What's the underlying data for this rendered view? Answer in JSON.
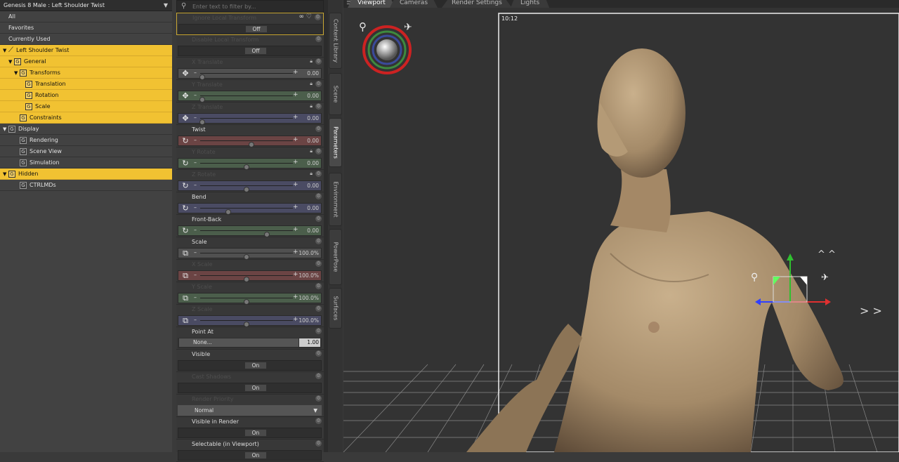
{
  "node_selector": {
    "label": "Genesis 8 Male : Left Shoulder Twist",
    "arrow": "▼"
  },
  "tree": [
    {
      "label": "All",
      "indent": 0,
      "selected": false,
      "toggle": "",
      "icon": ""
    },
    {
      "label": "Favorites",
      "indent": 0,
      "selected": false,
      "toggle": "",
      "icon": ""
    },
    {
      "label": "Currently Used",
      "indent": 0,
      "selected": false,
      "toggle": "",
      "icon": ""
    },
    {
      "label": "Left Shoulder Twist",
      "indent": 0,
      "selected": true,
      "toggle": "▼",
      "icon": "bone"
    },
    {
      "label": "General",
      "indent": 1,
      "selected": true,
      "toggle": "▼",
      "icon": "G"
    },
    {
      "label": "Transforms",
      "indent": 2,
      "selected": true,
      "toggle": "▼",
      "icon": "G"
    },
    {
      "label": "Translation",
      "indent": 3,
      "selected": true,
      "toggle": "",
      "icon": "G"
    },
    {
      "label": "Rotation",
      "indent": 3,
      "selected": true,
      "toggle": "",
      "icon": "G"
    },
    {
      "label": "Scale",
      "indent": 3,
      "selected": true,
      "toggle": "",
      "icon": "G"
    },
    {
      "label": "Constraints",
      "indent": 2,
      "selected": true,
      "toggle": "",
      "icon": "G"
    },
    {
      "label": "Display",
      "indent": 0,
      "selected": false,
      "toggle": "▼",
      "icon": "G"
    },
    {
      "label": "Rendering",
      "indent": 2,
      "selected": false,
      "toggle": "",
      "icon": "G"
    },
    {
      "label": "Scene View",
      "indent": 2,
      "selected": false,
      "toggle": "",
      "icon": "G"
    },
    {
      "label": "Simulation",
      "indent": 2,
      "selected": false,
      "toggle": "",
      "icon": "G"
    },
    {
      "label": "Hidden",
      "indent": 0,
      "selected": true,
      "toggle": "▼",
      "icon": "G"
    },
    {
      "label": "CTRLMDs",
      "indent": 2,
      "selected": false,
      "toggle": "",
      "icon": "G"
    }
  ],
  "search": {
    "placeholder": "Enter text to filter by..."
  },
  "params": [
    {
      "kind": "toggle",
      "label": "Ignore Local Transform",
      "dim": true,
      "value": "Off",
      "highlight": true
    },
    {
      "kind": "toggle",
      "label": "Disable Local Transform",
      "dim": true,
      "value": "Off"
    },
    {
      "kind": "slider",
      "label": "X Translate",
      "dim": true,
      "color": "#505050",
      "icon": "move",
      "pos": 0.02,
      "value": "0.00",
      "lock": true
    },
    {
      "kind": "slider",
      "label": "Y Translate",
      "dim": true,
      "color": "#4b5e4b",
      "icon": "move",
      "pos": 0.02,
      "value": "0.00",
      "lock": true
    },
    {
      "kind": "slider",
      "label": "Z Translate",
      "dim": true,
      "color": "#4a4b63",
      "icon": "move",
      "pos": 0.02,
      "value": "0.00",
      "lock": true
    },
    {
      "kind": "slider",
      "label": "Twist",
      "dim": false,
      "color": "#6b4444",
      "icon": "rotate",
      "pos": 0.55,
      "value": "0.00",
      "lock": false
    },
    {
      "kind": "slider",
      "label": "Y Rotate",
      "dim": true,
      "color": "#4b5e4b",
      "icon": "rotate",
      "pos": 0.5,
      "value": "0.00",
      "lock": true
    },
    {
      "kind": "slider",
      "label": "Z Rotate",
      "dim": true,
      "color": "#4a4b63",
      "icon": "rotate",
      "pos": 0.5,
      "value": "0.00",
      "lock": true
    },
    {
      "kind": "slider",
      "label": "Bend",
      "dim": false,
      "color": "#4a4b63",
      "icon": "rotate",
      "pos": 0.3,
      "value": "0.00",
      "lock": false
    },
    {
      "kind": "slider",
      "label": "Front-Back",
      "dim": false,
      "color": "#4b5e4b",
      "icon": "rotate",
      "pos": 0.72,
      "value": "0.00",
      "lock": false
    },
    {
      "kind": "slider",
      "label": "Scale",
      "dim": false,
      "color": "#505050",
      "icon": "scale",
      "pos": 0.5,
      "value": "100.0%",
      "lock": false
    },
    {
      "kind": "slider",
      "label": "X Scale",
      "dim": true,
      "color": "#6b4444",
      "icon": "scale",
      "pos": 0.5,
      "value": "100.0%",
      "lock": false
    },
    {
      "kind": "slider",
      "label": "Y Scale",
      "dim": true,
      "color": "#4b5e4b",
      "icon": "scale",
      "pos": 0.5,
      "value": "100.0%",
      "lock": false
    },
    {
      "kind": "slider",
      "label": "Z Scale",
      "dim": true,
      "color": "#4a4b63",
      "icon": "scale",
      "pos": 0.5,
      "value": "100.0%",
      "lock": false
    },
    {
      "kind": "pointat",
      "label": "Point At",
      "dim": false,
      "value": "None...",
      "num": "1.00"
    },
    {
      "kind": "toggle",
      "label": "Visible",
      "dim": false,
      "value": "On"
    },
    {
      "kind": "toggle",
      "label": "Cast Shadows",
      "dim": true,
      "value": "On"
    },
    {
      "kind": "dropdown",
      "label": "Render Priority",
      "dim": true,
      "value": "Normal"
    },
    {
      "kind": "toggle",
      "label": "Visible in Render",
      "dim": false,
      "value": "On"
    },
    {
      "kind": "toggle",
      "label": "Selectable (in Viewport)",
      "dim": false,
      "value": "On"
    }
  ],
  "side_tabs": [
    {
      "label": "Content Library",
      "active": false
    },
    {
      "label": "Scene",
      "active": false
    },
    {
      "label": "Parameters",
      "active": true
    },
    {
      "label": "Environment",
      "active": false
    },
    {
      "label": "PowerPose",
      "active": false
    },
    {
      "label": "Surfaces",
      "active": false
    }
  ],
  "viewport": {
    "tabs": [
      {
        "label": "Viewport",
        "active": true
      },
      {
        "label": "Cameras",
        "active": false
      },
      {
        "label": "Render Settings",
        "active": false
      },
      {
        "label": "Lights",
        "active": false
      }
    ],
    "frame_time": "10:12",
    "skin_color": "#b9a07e",
    "background": "#333333",
    "grid_color": "#dddddd"
  }
}
